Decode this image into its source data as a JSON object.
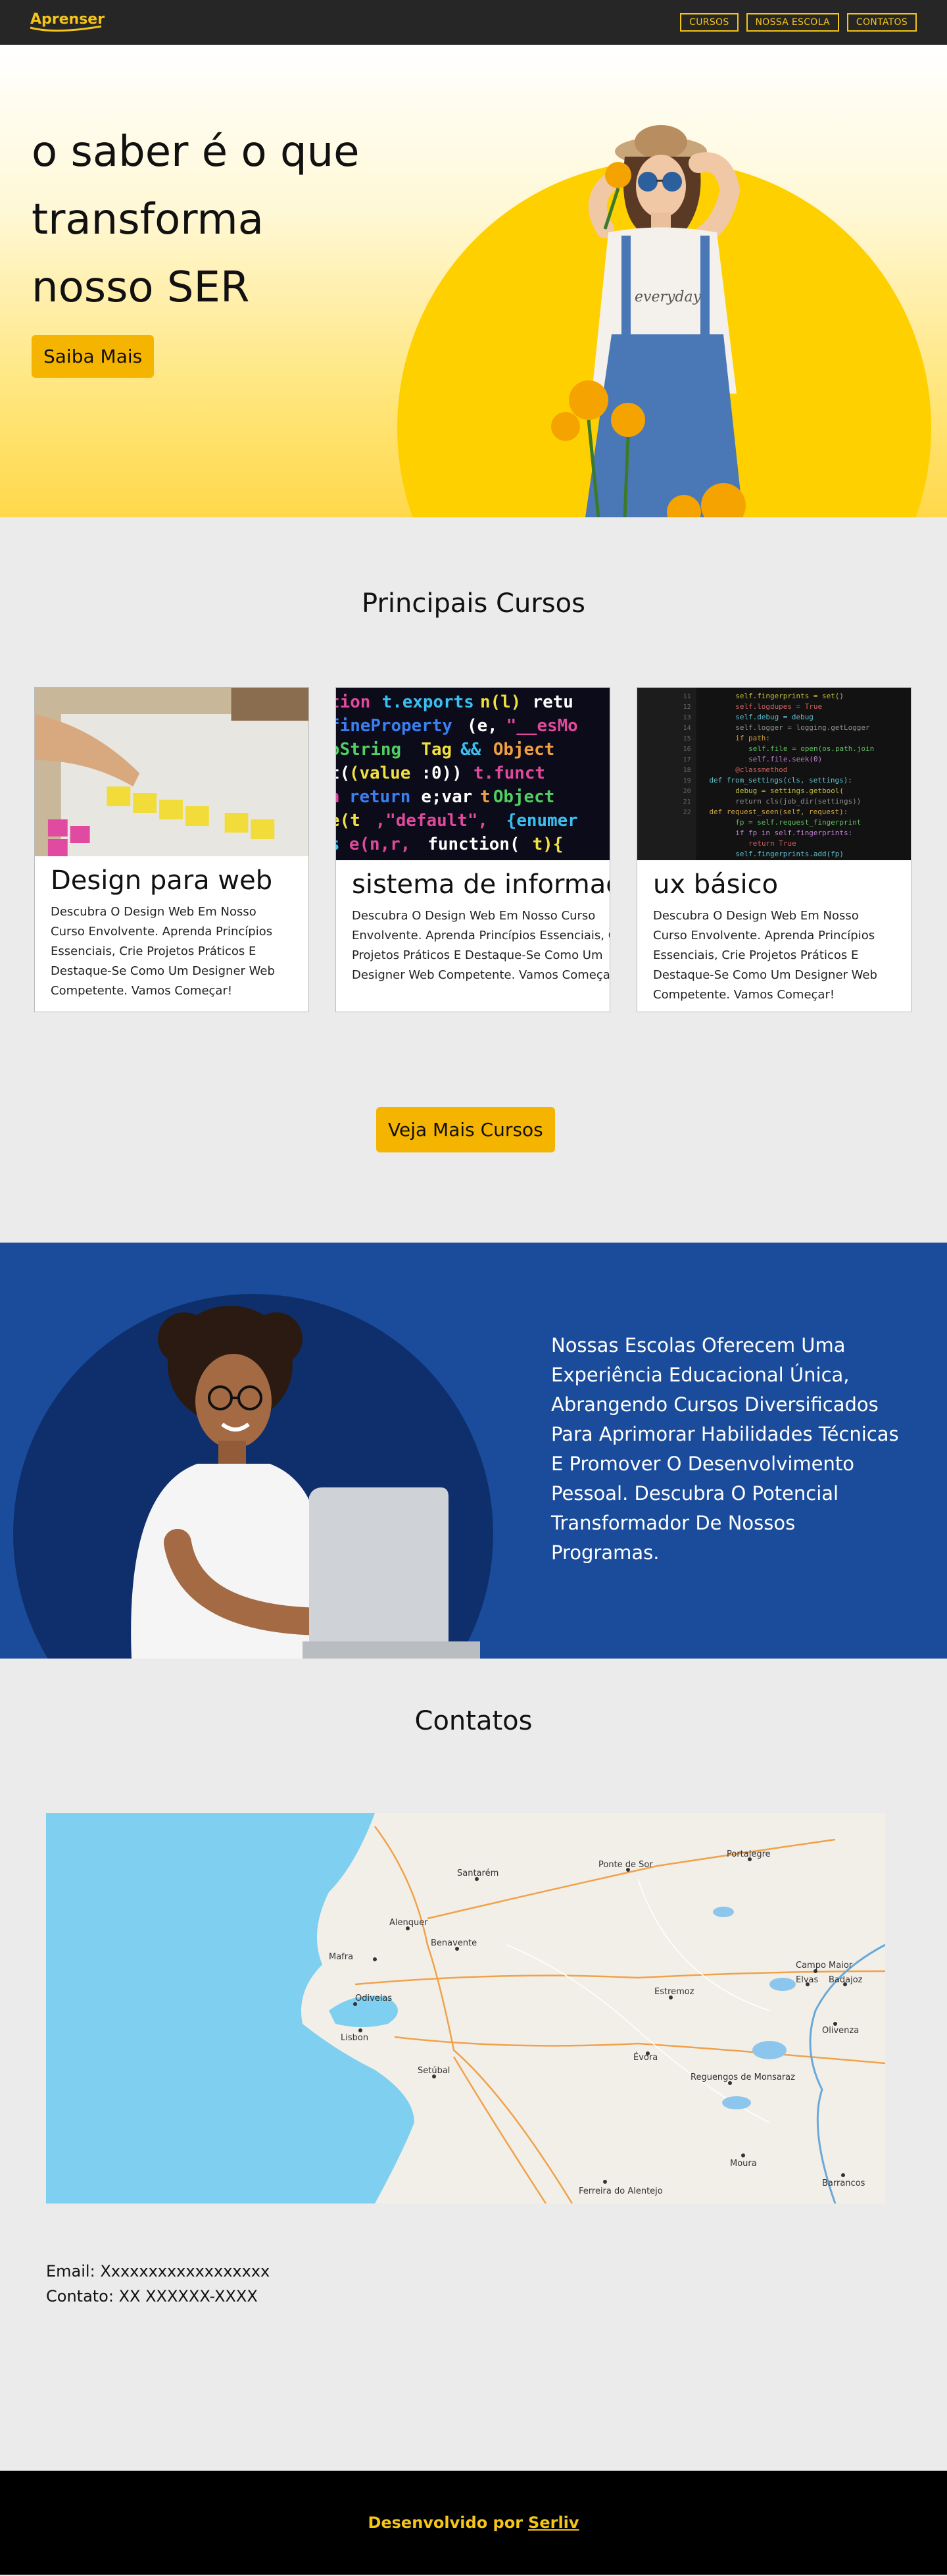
{
  "nav": {
    "logo": "Aprenser",
    "links": [
      "CURSOS",
      "NOSSA ESCOLA",
      "CONTATOS"
    ]
  },
  "hero": {
    "title_line1": "o saber é o que",
    "title_line2": "transforma",
    "title_line3": "nosso SER",
    "button": "Saiba Mais"
  },
  "courses": {
    "title": "Principais Cursos",
    "cards": [
      {
        "title": "Design para web",
        "desc": "Descubra O Design Web Em Nosso Curso Envolvente. Aprenda Princípios Essenciais, Crie Projetos Práticos E Destaque-Se Como Um Designer Web Competente. Vamos Começar!"
      },
      {
        "title": "sistema de informação",
        "desc": "Descubra O Design Web Em Nosso Curso Envolvente. Aprenda Princípios Essenciais, Crie Projetos Práticos E Destaque-Se Como Um Designer Web Competente. Vamos Começar!"
      },
      {
        "title": "ux básico",
        "desc": "Descubra O Design Web Em Nosso Curso Envolvente. Aprenda Princípios Essenciais, Crie Projetos Práticos E Destaque-Se Como Um Designer Web Competente. Vamos Começar!"
      }
    ],
    "more_button": "Veja Mais Cursos"
  },
  "school": {
    "text": "Nossas Escolas Oferecem Uma Experiência Educacional Única, Abrangendo Cursos Diversificados Para Aprimorar Habilidades  Técnicas E Promover O Desenvolvimento Pessoal. Descubra O Potencial Transformador De Nossos Programas."
  },
  "contacts": {
    "title": "Contatos",
    "map_labels": [
      "Santarém",
      "Ponte de Sor",
      "Portalegre",
      "Alenquer",
      "Benavente",
      "Mafra",
      "Odivelas",
      "Lisbon",
      "Estremoz",
      "Campo Maior",
      "Elvas",
      "Badajoz",
      "Olivenza",
      "Évora",
      "Setúbal",
      "Reguengos de Monsaraz",
      "Moura",
      "Barrancos",
      "Ferreira do Alentejo"
    ],
    "email_label": "Email:",
    "email_value": "Xxxxxxxxxxxxxxxxxx",
    "contact_label": "Contato:",
    "contact_value": "XX XXXXXX-XXXX"
  },
  "footer": {
    "text": "Desenvolvido por",
    "link": "Serliv"
  },
  "colors": {
    "accent": "#f5b400",
    "nav_bg": "#262626",
    "school_bg": "#1b4c9b",
    "footer_bg": "#000000"
  }
}
